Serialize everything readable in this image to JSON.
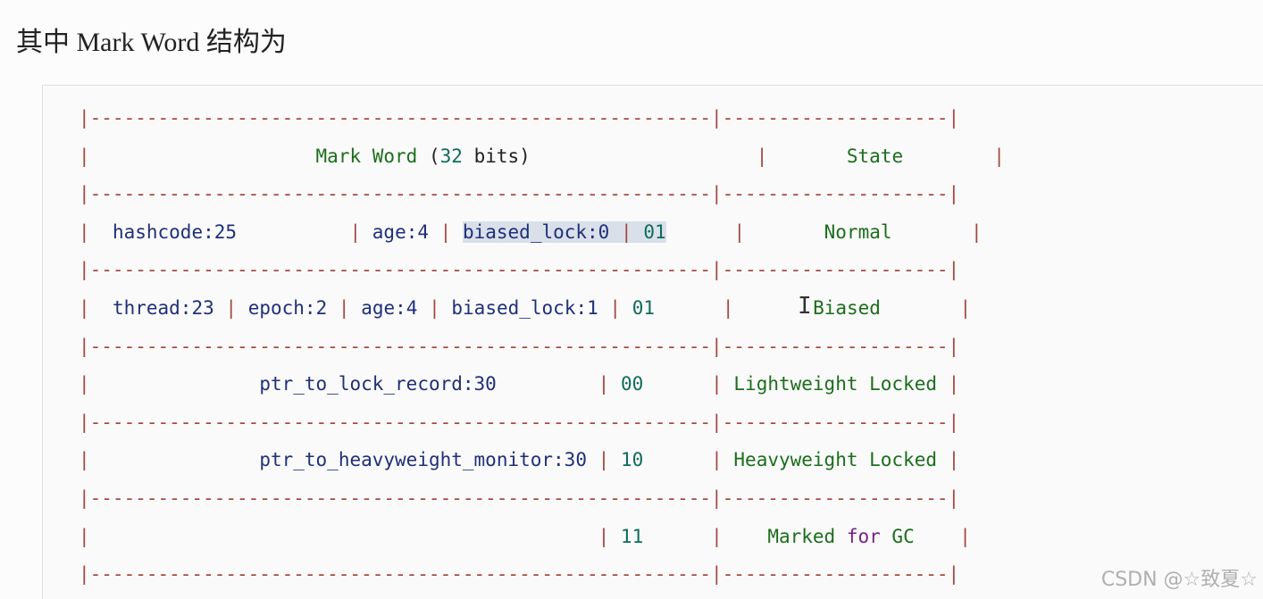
{
  "heading": "其中 Mark Word 结构为",
  "table": {
    "rule": "|-------------------------------------------------------|--------------------|",
    "header": {
      "mark_word": "Mark Word",
      "bits": "32",
      "bits_label": "bits",
      "state": "State"
    },
    "rows": [
      {
        "fields": [
          "hashcode:25",
          "age:4",
          "biased_lock:0"
        ],
        "flag": "01",
        "state": "Normal"
      },
      {
        "fields": [
          "thread:23",
          "epoch:2",
          "age:4",
          "biased_lock:1"
        ],
        "flag": "01",
        "state": "Biased"
      },
      {
        "fields": [
          "ptr_to_lock_record:30"
        ],
        "flag": "00",
        "state": "Lightweight Locked"
      },
      {
        "fields": [
          "ptr_to_heavyweight_monitor:30"
        ],
        "flag": "10",
        "state": "Heavyweight Locked"
      },
      {
        "fields": [],
        "flag": "11",
        "state_a": "Marked",
        "state_kw": "for",
        "state_b": "GC"
      }
    ]
  },
  "watermark": "CSDN @☆致夏☆",
  "icons": {
    "cursor": "text-cursor-icon"
  }
}
